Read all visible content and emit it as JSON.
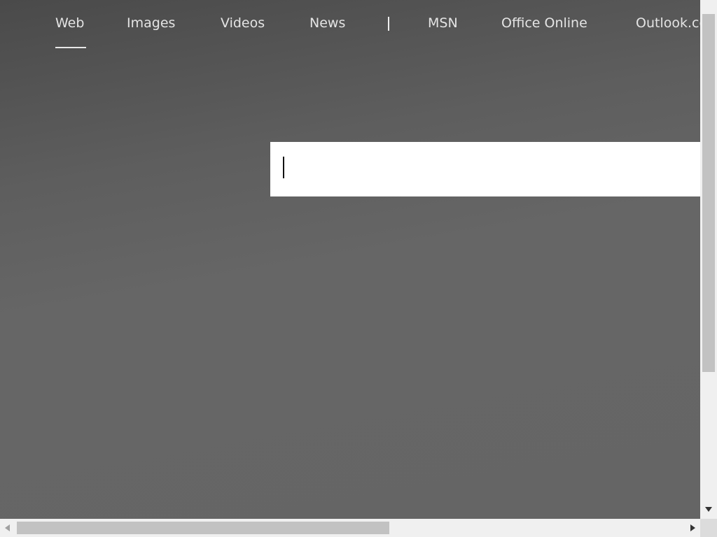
{
  "nav": {
    "items": [
      {
        "label": "Web",
        "active": true
      },
      {
        "label": "Images"
      },
      {
        "label": "Videos"
      },
      {
        "label": "News"
      },
      {
        "label": "MSN"
      },
      {
        "label": "Office Online"
      },
      {
        "label": "Outlook.com"
      }
    ]
  },
  "search": {
    "value": "",
    "placeholder": ""
  }
}
